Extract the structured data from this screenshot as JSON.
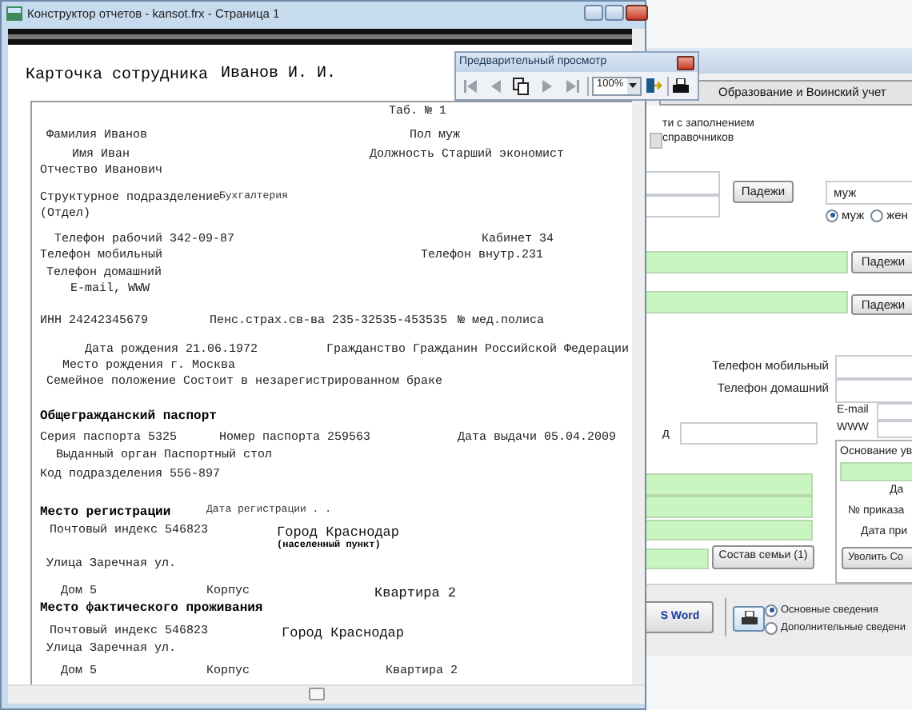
{
  "report_window": {
    "title": "Конструктор отчетов - kansot.frx - Страница 1",
    "rows": [
      {
        "cells": [
          {
            "text": "Карточка сотрудника",
            "kind": "title"
          },
          {
            "text": "Иванов И. И.",
            "kind": "title"
          }
        ]
      },
      {
        "cells": [
          {
            "text": "Таб. № 1",
            "kind": "normal"
          }
        ]
      },
      {
        "cells": [
          {
            "text": "Фамилия Иванов",
            "kind": "normal"
          },
          {
            "text": "Пол муж",
            "kind": "normal"
          }
        ]
      },
      {
        "cells": [
          {
            "text": "Имя Иван",
            "kind": "normal"
          },
          {
            "text": "Должность Старший экономист",
            "kind": "normal"
          }
        ]
      },
      {
        "cells": [
          {
            "text": "Отчество Иванович",
            "kind": "normal"
          }
        ]
      },
      {
        "cells": [
          {
            "text": "Структурное подразделение",
            "kind": "normal"
          },
          {
            "text": "Бухгалтерия",
            "kind": "small"
          }
        ]
      },
      {
        "cells": [
          {
            "text": "(Отдел)",
            "kind": "normal"
          }
        ]
      },
      {
        "cells": [
          {
            "text": "Телефон рабочий 342-09-87",
            "kind": "normal"
          },
          {
            "text": "Кабинет 34",
            "kind": "normal"
          }
        ]
      },
      {
        "cells": [
          {
            "text": "Телефон мобильный",
            "kind": "normal"
          },
          {
            "text": "Телефон внутр.231",
            "kind": "normal"
          }
        ]
      },
      {
        "cells": [
          {
            "text": "Телефон домашний",
            "kind": "normal"
          }
        ]
      },
      {
        "cells": [
          {
            "text": "E-mail, WWW",
            "kind": "normal"
          }
        ]
      },
      {
        "cells": [
          {
            "text": "ИНН 24242345679",
            "kind": "normal"
          },
          {
            "text": "Пенс.страх.св-ва 235-32535-453535",
            "kind": "normal"
          },
          {
            "text": "№ мед.полиса",
            "kind": "normal"
          }
        ]
      },
      {
        "cells": [
          {
            "text": "Дата рождения 21.06.1972",
            "kind": "normal"
          },
          {
            "text": "Гражданство Гражданин Российской Федерации",
            "kind": "normal"
          }
        ]
      },
      {
        "cells": [
          {
            "text": "Место рождения г. Москва",
            "kind": "normal"
          }
        ]
      },
      {
        "cells": [
          {
            "text": "Семейное положение Состоит в незарегистрированном браке",
            "kind": "normal"
          }
        ]
      },
      {
        "cells": [
          {
            "text": "Общегражданский паспорт",
            "kind": "bold"
          }
        ]
      },
      {
        "cells": [
          {
            "text": "Серия паспорта 5325",
            "kind": "normal"
          },
          {
            "text": "Номер паспорта 259563",
            "kind": "normal"
          },
          {
            "text": "Дата выдачи 05.04.2009",
            "kind": "normal"
          }
        ]
      },
      {
        "cells": [
          {
            "text": "Выданный орган Паспортный стол",
            "kind": "normal"
          }
        ]
      },
      {
        "cells": [
          {
            "text": "Код подразделения 556-897",
            "kind": "normal"
          }
        ]
      },
      {
        "cells": [
          {
            "text": "Место регистрации",
            "kind": "bold"
          },
          {
            "text": "Дата регистрации . .",
            "kind": "small"
          }
        ]
      },
      {
        "cells": [
          {
            "text": "Почтовый индекс 546823",
            "kind": "normal"
          },
          {
            "text": "Город Краснодар",
            "kind": "large"
          }
        ]
      },
      {
        "cells": [
          {
            "text": "(населенный пункт)",
            "kind": "caption"
          }
        ]
      },
      {
        "cells": [
          {
            "text": "Улица Заречная ул.",
            "kind": "normal"
          }
        ]
      },
      {
        "cells": [
          {
            "text": "Дом 5",
            "kind": "normal"
          },
          {
            "text": "Корпус",
            "kind": "normal"
          },
          {
            "text": "Квартира 2",
            "kind": "large"
          }
        ]
      },
      {
        "cells": [
          {
            "text": "Место фактического проживания",
            "kind": "bold"
          }
        ]
      },
      {
        "cells": [
          {
            "text": "Почтовый индекс 546823",
            "kind": "normal"
          },
          {
            "text": "Город Краснодар",
            "kind": "large"
          }
        ]
      },
      {
        "cells": [
          {
            "text": "Улица Заречная ул.",
            "kind": "normal"
          }
        ]
      },
      {
        "cells": [
          {
            "text": "Дом 5",
            "kind": "normal"
          },
          {
            "text": "Корпус",
            "kind": "normal"
          },
          {
            "text": "Квартира 2",
            "kind": "normal"
          }
        ]
      }
    ]
  },
  "preview_toolbar": {
    "title": "Предварительный просмотр",
    "zoom": "100%",
    "buttons": [
      {
        "kind": "first",
        "disabled": true
      },
      {
        "kind": "prev",
        "disabled": true
      },
      {
        "kind": "copy",
        "disabled": false
      },
      {
        "kind": "next",
        "disabled": true
      },
      {
        "kind": "last",
        "disabled": true
      }
    ]
  },
  "employee_window": {
    "tab": {
      "label": "Образование и Воинский учет",
      "selected": true
    },
    "hint": "ти с заполнением справочников",
    "gender_field": "муж",
    "gender_options": [
      {
        "label": "муж",
        "selected": true
      },
      {
        "label": "жен",
        "selected": false
      }
    ],
    "declension_buttons": [
      "Падежи",
      "Падежи",
      "Падежи"
    ],
    "phone_labels": [
      "Телефон мобильный",
      "Телефон домашний"
    ],
    "contact_labels": [
      "E-mail",
      "WWW"
    ],
    "fragment_label": "д",
    "dismissal": {
      "basis": "Основание ув",
      "labels": [
        "Да",
        "№ приказа",
        "Дата при"
      ],
      "button": "Уволить Со"
    },
    "family_button": "Состав семьи (1)",
    "bottom_bar": {
      "word_button": "S Word",
      "options": [
        {
          "label": "Основные сведения",
          "selected": true
        },
        {
          "label": "Дополнительные сведени",
          "selected": false
        }
      ]
    }
  }
}
